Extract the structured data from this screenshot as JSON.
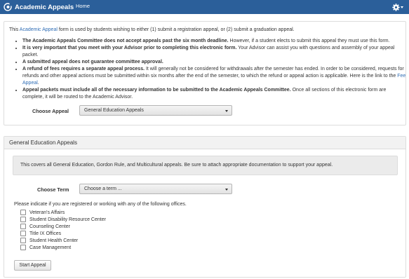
{
  "nav": {
    "app_title": "Academic Appeals",
    "home_label": "Home",
    "logo_icon": "academic-logo-icon",
    "settings_icon": "gear-icon",
    "bar_color": "#2b5f9a"
  },
  "intro": {
    "before_link": "This ",
    "link_text": "Academic Appeal",
    "after_link": " form is used by students wishing to either (1) submit a registration appeal, or (2) submit a graduation appeal."
  },
  "rules": [
    {
      "bold": "The Academic Appeals Committee does not accept appeals past the six month deadline.",
      "text": " However, if a student elects to submit this appeal they must use this form."
    },
    {
      "bold": "It is very important that you meet with your Advisor prior to completing this electronic form.",
      "text": " Your Advisor can assist you with questions and assembly of your appeal packet."
    },
    {
      "bold": "A submitted appeal does not guarantee committee approval.",
      "text": ""
    },
    {
      "bold": "A refund of fees requires a separate appeal process.",
      "text": " It will generally not be considered for withdrawals after the semester has ended. In order to be considered, requests for refunds and other appeal actions must be submitted within six months after the end of the semester, to which the refund or appeal action is applicable. Here is the link to the ",
      "link": "Fee Appeal",
      "after_link": "."
    },
    {
      "bold": "Appeal packets must include all of the necessary information to be submitted to the Academic Appeals Committee.",
      "text": " Once all sections of this electronic form are complete, it will be routed to the Academic Advisor."
    }
  ],
  "choose_appeal": {
    "label": "Choose Appeal",
    "selected": "General Education Appeals"
  },
  "section": {
    "title": "General Education Appeals",
    "info_text": "This covers all General Education, Gordon Rule, and Multicultural appeals. Be sure to attach appropriate documentation to support your appeal."
  },
  "choose_term": {
    "label": "Choose Term",
    "selected": "Choose a term ..."
  },
  "offices": {
    "prompt": "Please indicate if you are registered or working with any of the following offices.",
    "items": [
      {
        "label": "Veteran's Affairs",
        "checked": false
      },
      {
        "label": "Student Disability Resource Center",
        "checked": false
      },
      {
        "label": "Counseling Center",
        "checked": false
      },
      {
        "label": "Title IX Offices",
        "checked": false
      },
      {
        "label": "Student Health Center",
        "checked": false
      },
      {
        "label": "Case Management",
        "checked": false
      }
    ]
  },
  "start_button": "Start Appeal"
}
